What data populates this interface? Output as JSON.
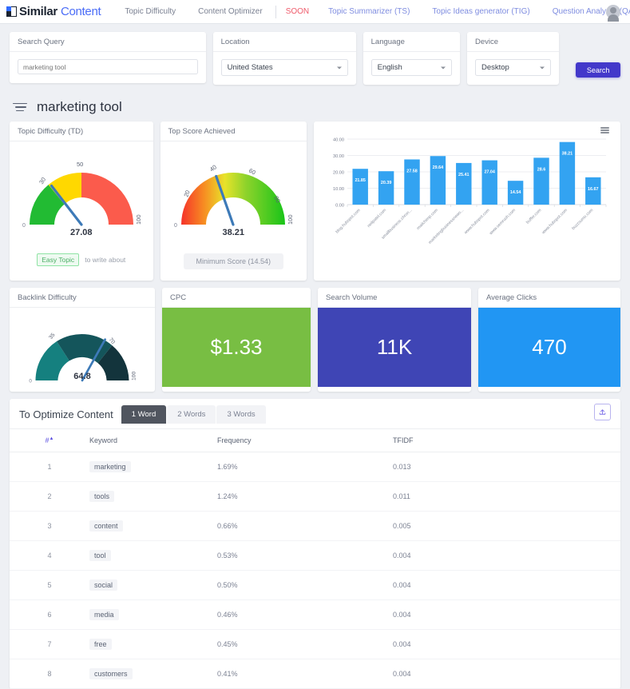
{
  "nav": {
    "logo_primary": "Similar",
    "logo_secondary": "Content",
    "links": [
      {
        "label": "Topic Difficulty",
        "style": "muted"
      },
      {
        "label": "Content Optimizer",
        "style": "muted"
      }
    ],
    "soon_label": "SOON",
    "soon_links": [
      {
        "label": "Topic Summarizer (TS)"
      },
      {
        "label": "Topic Ideas generator (TIG)"
      },
      {
        "label": "Question Analyzer (QA)"
      }
    ],
    "avatar_icon": "user-avatar-icon"
  },
  "filters": {
    "search_query": {
      "label": "Search Query",
      "value": "",
      "placeholder": "marketing tool"
    },
    "location": {
      "label": "Location",
      "value": "United States"
    },
    "language": {
      "label": "Language",
      "value": "English"
    },
    "device": {
      "label": "Device",
      "value": "Desktop"
    },
    "search_button": "Search"
  },
  "page": {
    "title": "marketing tool"
  },
  "topic_difficulty": {
    "card_title": "Topic Difficulty (TD)",
    "value": "27.08",
    "value_num": 27.08,
    "ticks": [
      "0",
      "30",
      "50",
      "100"
    ],
    "badge": "Easy Topic",
    "note": "to write about",
    "bands": [
      {
        "from": 0,
        "to": 30,
        "color": "#22bb33"
      },
      {
        "from": 30,
        "to": 50,
        "color": "#ffd800"
      },
      {
        "from": 50,
        "to": 100,
        "color": "#fb5b4c"
      }
    ]
  },
  "top_score": {
    "card_title": "Top Score Achieved",
    "value": "38.21",
    "value_num": 38.21,
    "ticks": [
      "0",
      "20",
      "40",
      "60",
      "80",
      "100"
    ],
    "footer": "Minimum Score (14.54)"
  },
  "backlink_difficulty": {
    "card_title": "Backlink Difficulty",
    "value": "64.8",
    "value_num": 64.8,
    "ticks": [
      "0",
      "35",
      "70",
      "100"
    ],
    "bands": [
      {
        "from": 0,
        "to": 35,
        "color": "#15807f"
      },
      {
        "from": 35,
        "to": 70,
        "color": "#14555b"
      },
      {
        "from": 70,
        "to": 100,
        "color": "#13343c"
      }
    ]
  },
  "cpc": {
    "card_title": "CPC",
    "value": "$1.33",
    "color": "#78be43"
  },
  "search_volume": {
    "card_title": "Search Volume",
    "value": "11K",
    "color": "#3f45b5"
  },
  "average_clicks": {
    "card_title": "Average Clicks",
    "value": "470",
    "color": "#2196f3"
  },
  "chart_data": {
    "type": "bar",
    "title": "",
    "xlabel": "",
    "ylabel": "",
    "ylim": [
      0,
      40
    ],
    "grid": true,
    "legend": false,
    "yticks": [
      "0.00",
      "10.00",
      "20.00",
      "30.00",
      "40.00"
    ],
    "bar_color": "#33a3f1",
    "menu_icon": "hamburger-menu-icon",
    "categories": [
      "blog.hubspot.com",
      "neilpatel.com",
      "smallbusiness.chron...",
      "mailchimp.com",
      "marketingbusinessnews...",
      "www.hubspot.com",
      "www.semrush.com",
      "buffer.com",
      "www.hubspot.com",
      "buzzsumo.com"
    ],
    "values": [
      21.85,
      20.39,
      27.58,
      29.64,
      25.41,
      27.04,
      14.54,
      28.6,
      38.21,
      16.67
    ],
    "labels": [
      "21.85",
      "20.39",
      "27.58",
      "29.64",
      "25.41",
      "27.04",
      "14.54",
      "28.6",
      "38.21",
      "16.67"
    ]
  },
  "optimize": {
    "title": "To Optimize Content",
    "tabs": [
      {
        "label": "1 Word",
        "active": true
      },
      {
        "label": "2 Words",
        "active": false
      },
      {
        "label": "3 Words",
        "active": false
      }
    ],
    "export_icon": "export-upload-icon",
    "columns": [
      "#",
      "Keyword",
      "Frequency",
      "TFIDF"
    ],
    "rows": [
      {
        "num": "1",
        "keyword": "marketing",
        "frequency": "1.69%",
        "tfidf": "0.013"
      },
      {
        "num": "2",
        "keyword": "tools",
        "frequency": "1.24%",
        "tfidf": "0.011"
      },
      {
        "num": "3",
        "keyword": "content",
        "frequency": "0.66%",
        "tfidf": "0.005"
      },
      {
        "num": "4",
        "keyword": "tool",
        "frequency": "0.53%",
        "tfidf": "0.004"
      },
      {
        "num": "5",
        "keyword": "social",
        "frequency": "0.50%",
        "tfidf": "0.004"
      },
      {
        "num": "6",
        "keyword": "media",
        "frequency": "0.46%",
        "tfidf": "0.004"
      },
      {
        "num": "7",
        "keyword": "free",
        "frequency": "0.45%",
        "tfidf": "0.004"
      },
      {
        "num": "8",
        "keyword": "customers",
        "frequency": "0.41%",
        "tfidf": "0.004"
      }
    ]
  }
}
